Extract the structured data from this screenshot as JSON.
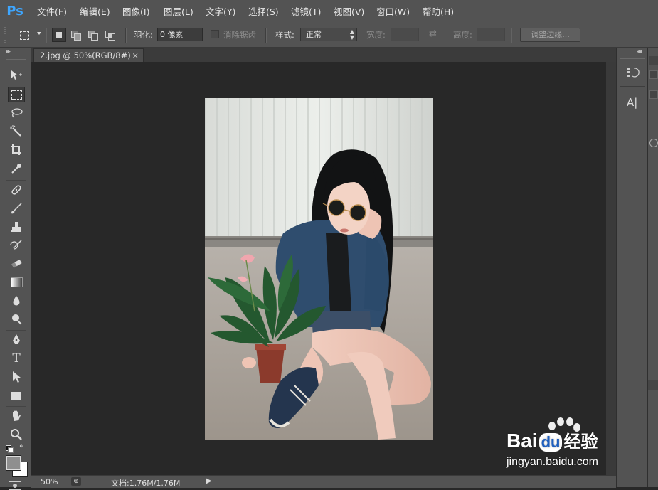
{
  "app": {
    "logo": "Ps"
  },
  "menu": [
    "文件(F)",
    "编辑(E)",
    "图像(I)",
    "图层(L)",
    "文字(Y)",
    "选择(S)",
    "滤镜(T)",
    "视图(V)",
    "窗口(W)",
    "帮助(H)"
  ],
  "options": {
    "feather_label": "羽化:",
    "feather_value": "0 像素",
    "antialias_label": "消除锯齿",
    "style_label": "样式:",
    "style_value": "正常",
    "width_label": "宽度:",
    "height_label": "高度:",
    "refine_edge_button": "调整边缘..."
  },
  "document": {
    "tab_title": "2.jpg @ 50%(RGB/8#)",
    "close_glyph": "×"
  },
  "status": {
    "zoom": "50%",
    "doc_info": "文档:1.76M/1.76M"
  },
  "right_panel": {
    "char_panel_glyph": "A|"
  },
  "watermark": {
    "brand_latin": "Bai",
    "brand_du": "du",
    "brand_cn": "经验",
    "url": "jingyan.baidu.com"
  },
  "colors": {
    "ui_gray": "#535353",
    "canvas_bg": "#282828",
    "ps_blue": "#3ea6ff"
  }
}
